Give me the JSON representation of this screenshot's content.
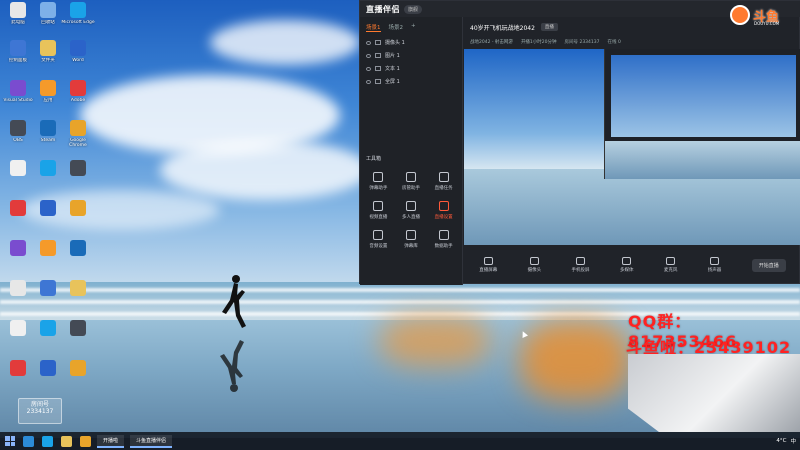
{
  "desktop": {
    "icons": [
      {
        "label": "此电脑",
        "color": "#e7e7e7"
      },
      {
        "label": "回收站",
        "color": "#7db0e8"
      },
      {
        "label": "Microsoft Edge",
        "color": "#1aa3e8"
      },
      {
        "label": "控制面板",
        "color": "#3e76d4"
      },
      {
        "label": "文件夹",
        "color": "#e8c35b"
      },
      {
        "label": "Word",
        "color": "#2b63c9"
      },
      {
        "label": "Visual Studio",
        "color": "#7a4ccf"
      },
      {
        "label": "应用",
        "color": "#f59a2a"
      },
      {
        "label": "Adobe",
        "color": "#e23b3b"
      },
      {
        "label": "OBS",
        "color": "#444a55"
      },
      {
        "label": "Steam",
        "color": "#1a6bb8"
      },
      {
        "label": "Google Chrome",
        "color": "#e8a42a"
      }
    ],
    "runner_alt": "running figure on beach"
  },
  "obs": {
    "app_name": "直播伴侣",
    "app_badge": "旗舰",
    "tabs": [
      "场景1",
      "场景2",
      "+"
    ],
    "sources": [
      "摄像头 1",
      "图片 1",
      "文本 1",
      "全屏 1"
    ],
    "tools_header": "工具箱",
    "tools": [
      {
        "label": "弹幕助手",
        "hot": false
      },
      {
        "label": "房管助手",
        "hot": false
      },
      {
        "label": "直播任务",
        "hot": false
      },
      {
        "label": "视频直播",
        "hot": false
      },
      {
        "label": "多人直播",
        "hot": false
      },
      {
        "label": "直播设置",
        "hot": true
      },
      {
        "label": "音频设置",
        "hot": false
      },
      {
        "label": "弹幕库",
        "hot": false
      },
      {
        "label": "数据助手",
        "hot": false
      }
    ],
    "room_title": "40岁开飞机玩战地2042",
    "room_tag": "直播",
    "info": [
      "战地2042 - 射击网游",
      "开播1小时20分钟",
      "房间号 2334137",
      "在线 0"
    ],
    "controls": [
      "直播屏幕",
      "摄像头",
      "手机投屏",
      "多媒体",
      "麦克风",
      "扬声器"
    ],
    "start_btn": "开始直播"
  },
  "overlay": {
    "qq_label": "QQ群：",
    "qq_num": "817353466",
    "room_label": "斗鱼啦：",
    "room_num": "23439102",
    "brand": "斗鱼",
    "brand_sub": "DOUYU.COM",
    "avatar_name": "房间号",
    "avatar_num": "2334137"
  },
  "taskbar": {
    "apps": [
      "开播啦",
      "斗鱼直播伴侣"
    ],
    "weather": "4°C",
    "time": "中"
  },
  "colors": {
    "accent": "#ff7a2f",
    "overlay_red": "#ff2222"
  }
}
